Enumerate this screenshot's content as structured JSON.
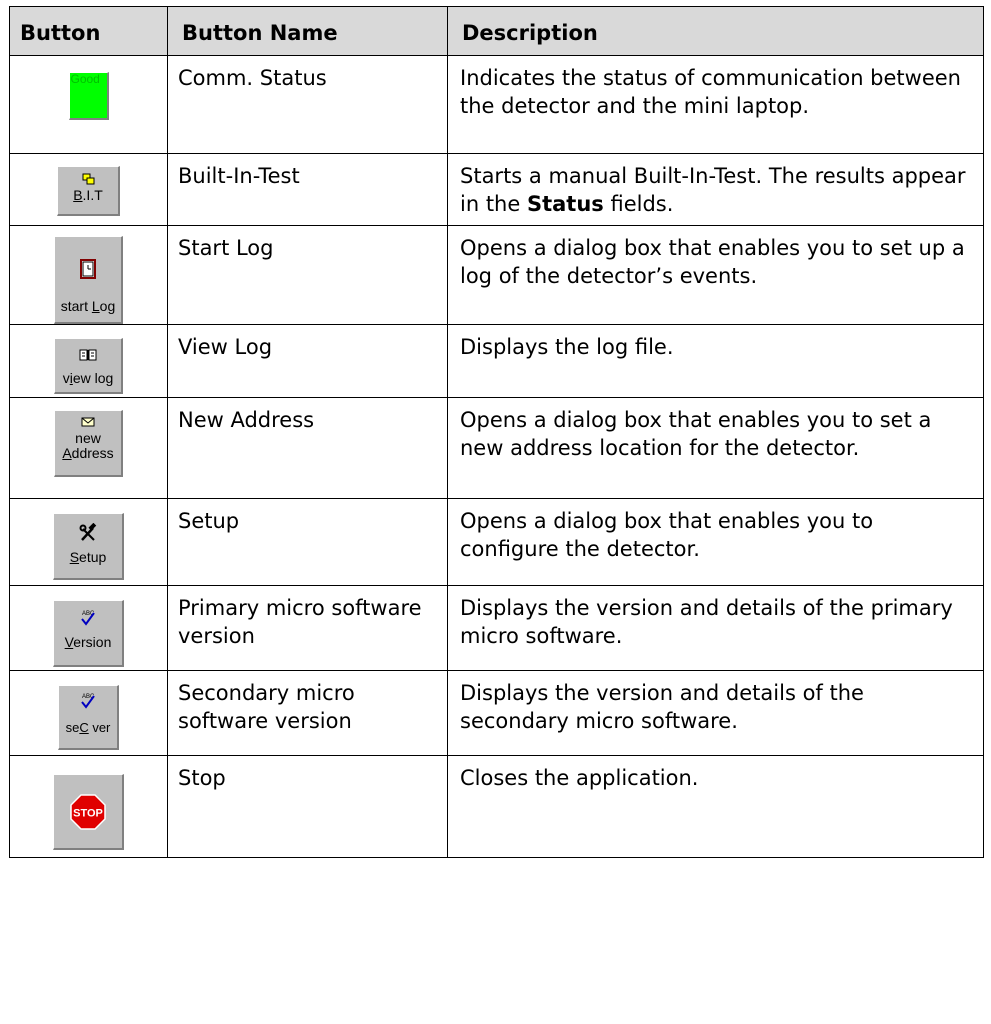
{
  "table": {
    "headers": [
      "Button",
      "Button Name",
      "Description"
    ],
    "rows": [
      {
        "button_label": "Good",
        "name": "Comm. Status",
        "description": "Indicates the status of communication between the detector and the mini laptop."
      },
      {
        "button_label_parts": [
          "B",
          ".I.T"
        ],
        "name": "Built-In-Test",
        "description_before": "Starts a manual Built-In-Test. The results appear in the ",
        "description_bold": "Status",
        "description_after": " fields."
      },
      {
        "button_label_parts": [
          "start ",
          "L",
          "og"
        ],
        "name": "Start Log",
        "description": "Opens a dialog box that enables you to set up a log of the detector’s events."
      },
      {
        "button_label_parts": [
          "v",
          "i",
          "ew log"
        ],
        "name": "View Log",
        "description": "Displays the log file."
      },
      {
        "button_label_line1": "new",
        "button_label_parts": [
          "",
          "A",
          "ddress"
        ],
        "name": "New Address",
        "description": "Opens a dialog box that enables you to set a new address location for the detector."
      },
      {
        "button_label_parts": [
          "",
          "S",
          "etup"
        ],
        "name": "Setup",
        "description": "Opens a dialog box that enables you to configure the detector."
      },
      {
        "button_label_parts": [
          "",
          "V",
          "ersion"
        ],
        "name": "Primary micro software version",
        "description": "Displays the version and details of the primary micro software."
      },
      {
        "button_label_parts": [
          "se",
          "C",
          " ver"
        ],
        "name": "Secondary micro software version",
        "description": "Displays the version and details of the secondary micro software."
      },
      {
        "button_label": "STOP",
        "name": "Stop",
        "description": "Closes the application."
      }
    ]
  },
  "icons": {
    "row2": "bit-test-icon",
    "row3": "clock-log-icon",
    "row4": "open-book-icon",
    "row5": "envelope-icon",
    "row6": "tools-icon",
    "row7": "spellcheck-icon",
    "row8": "spellcheck-icon",
    "row9": "stop-sign-icon"
  },
  "colors": {
    "status_good": "#00ff00",
    "button_face": "#c0c0c0",
    "header_bg": "#d9d9d9",
    "stop_red": "#e00000"
  }
}
